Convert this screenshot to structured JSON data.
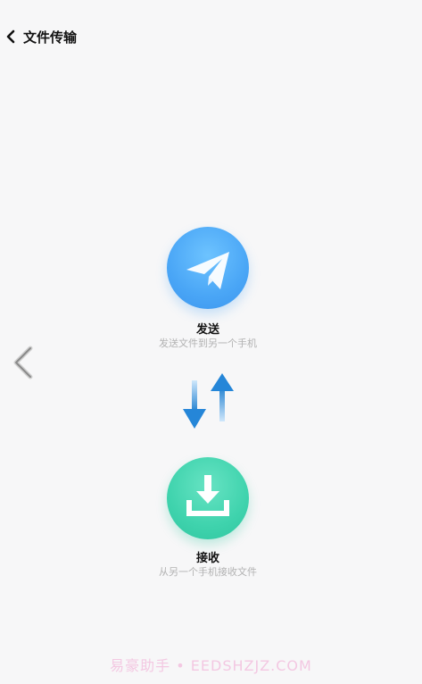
{
  "status_bar": {
    "left_text": "",
    "right_text": ""
  },
  "header": {
    "title": "文件传输",
    "back_icon": "chevron-left-icon"
  },
  "send": {
    "label": "发送",
    "description": "发送文件到另一个手机",
    "icon": "paper-plane-icon",
    "color": "#4aa6f6"
  },
  "transfer_arrows": {
    "icon": "up-down-arrows-icon",
    "color": "#2a86d6"
  },
  "receive": {
    "label": "接收",
    "description": "从另一个手机接收文件",
    "icon": "download-icon",
    "color": "#3fd3ad"
  },
  "watermark": {
    "text": "易豪助手 • EEDSHZJZ.COM"
  }
}
